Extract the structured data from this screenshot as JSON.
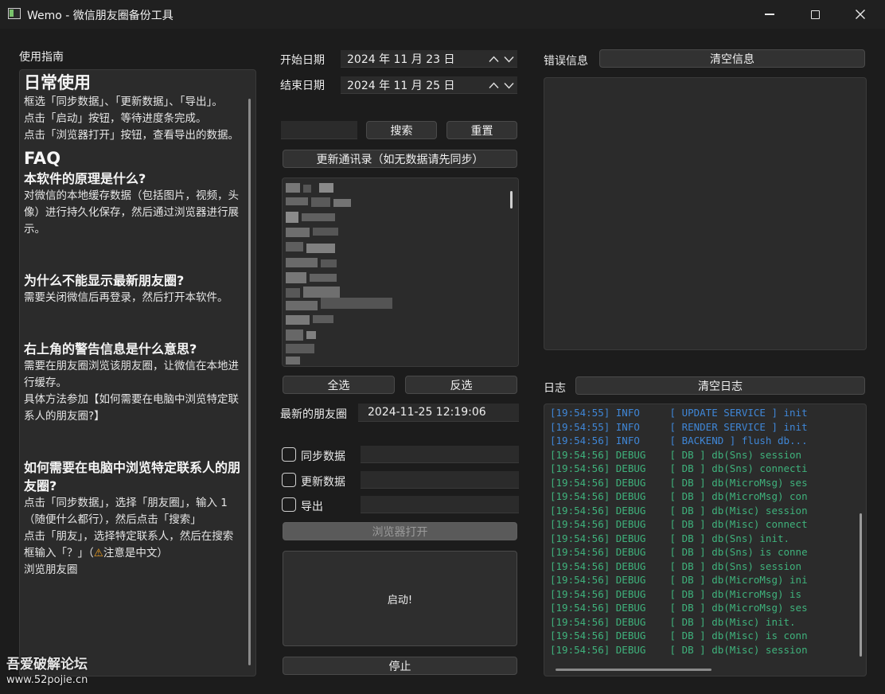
{
  "window": {
    "title": "Wemo - 微信朋友圈备份工具"
  },
  "guide": {
    "label": "使用指南",
    "h_daily": "日常使用",
    "daily_1": "框选「同步数据」、「更新数据」、「导出」。",
    "daily_2": "点击「启动」按钮，等待进度条完成。",
    "daily_3": "点击「浏览器打开」按钮，查看导出的数据。",
    "h_faq": "FAQ",
    "q1": "本软件的原理是什么?",
    "a1": "对微信的本地缓存数据（包括图片，视频，头像）进行持久化保存，然后通过浏览器进行展示。",
    "q2": "为什么不能显示最新朋友圈?",
    "a2": "需要关闭微信后再登录，然后打开本软件。",
    "q3": "右上角的警告信息是什么意思?",
    "a3_1": "需要在朋友圈浏览该朋友圈，让微信在本地进行缓存。",
    "a3_2": "具体方法参加【如何需要在电脑中浏览特定联系人的朋友圈?】",
    "q4": "如何需要在电脑中浏览特定联系人的朋友圈?",
    "a4_1": "点击「同步数据」，选择「朋友圈」，输入 1（随便什么都行），然后点击「搜索」",
    "a4_2_pre": "点击「朋友」，选择特定联系人，然后在搜索框输入「？」（",
    "a4_2_warn_icon": "⚠",
    "a4_2_post": "注意是中文）",
    "a4_3": "浏览朋友圈"
  },
  "dates": {
    "start_label": "开始日期",
    "start_value": "2024 年 11 月 23 日",
    "end_label": "结束日期",
    "end_value": "2024 年 11 月 25 日"
  },
  "search": {
    "value": "",
    "search_button": "搜索",
    "reset_button": "重置"
  },
  "update_contacts_button": "更新通讯录（如无数据请先同步）",
  "select_all_button": "全选",
  "invert_button": "反选",
  "latest": {
    "label": "最新的朋友圈",
    "value": "2024-11-25 12:19:06"
  },
  "options": [
    {
      "label": "同步数据",
      "checked": false
    },
    {
      "label": "更新数据",
      "checked": false
    },
    {
      "label": "导出",
      "checked": false
    }
  ],
  "browser_open_button": "浏览器打开",
  "start_button": "启动!",
  "stop_button": "停止",
  "errors": {
    "label": "错误信息",
    "clear_button": "清空信息"
  },
  "log": {
    "label": "日志",
    "clear_button": "清空日志",
    "lines": [
      {
        "level": "info",
        "text": "[19:54:55] INFO     [ UPDATE SERVICE ] init"
      },
      {
        "level": "info",
        "text": "[19:54:55] INFO     [ RENDER SERVICE ] init"
      },
      {
        "level": "info",
        "text": "[19:54:56] INFO     [ BACKEND ] flush db..."
      },
      {
        "level": "debug",
        "text": "[19:54:56] DEBUG    [ DB ] db(Sns) session"
      },
      {
        "level": "debug",
        "text": "[19:54:56] DEBUG    [ DB ] db(Sns) connecti"
      },
      {
        "level": "debug",
        "text": "[19:54:56] DEBUG    [ DB ] db(MicroMsg) ses"
      },
      {
        "level": "debug",
        "text": "[19:54:56] DEBUG    [ DB ] db(MicroMsg) con"
      },
      {
        "level": "debug",
        "text": "[19:54:56] DEBUG    [ DB ] db(Misc) session"
      },
      {
        "level": "debug",
        "text": "[19:54:56] DEBUG    [ DB ] db(Misc) connect"
      },
      {
        "level": "debug",
        "text": "[19:54:56] DEBUG    [ DB ] db(Sns) init."
      },
      {
        "level": "debug",
        "text": "[19:54:56] DEBUG    [ DB ] db(Sns) is conne"
      },
      {
        "level": "debug",
        "text": "[19:54:56] DEBUG    [ DB ] db(Sns) session"
      },
      {
        "level": "debug",
        "text": "[19:54:56] DEBUG    [ DB ] db(MicroMsg) ini"
      },
      {
        "level": "debug",
        "text": "[19:54:56] DEBUG    [ DB ] db(MicroMsg) is"
      },
      {
        "level": "debug",
        "text": "[19:54:56] DEBUG    [ DB ] db(MicroMsg) ses"
      },
      {
        "level": "debug",
        "text": "[19:54:56] DEBUG    [ DB ] db(Misc) init."
      },
      {
        "level": "debug",
        "text": "[19:54:56] DEBUG    [ DB ] db(Misc) is conn"
      },
      {
        "level": "debug",
        "text": "[19:54:56] DEBUG    [ DB ] db(Misc) session"
      }
    ]
  },
  "watermark": {
    "line1": "吾爱破解论坛",
    "line2": "www.52pojie.cn"
  },
  "colors": {
    "info": "#3f86d6",
    "debug": "#3fb27c",
    "warn": "#f0a020"
  }
}
